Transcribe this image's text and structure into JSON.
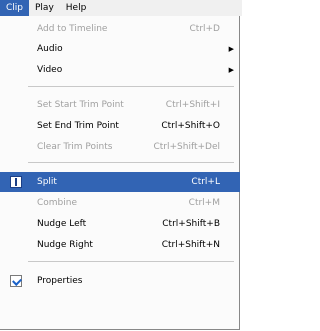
{
  "menubar": {
    "items": [
      {
        "label": "Clip",
        "active": true
      },
      {
        "label": "Play",
        "active": false
      },
      {
        "label": "Help",
        "active": false
      }
    ]
  },
  "menu": {
    "items": [
      {
        "label": "Add to Timeline",
        "shortcut": "Ctrl+D",
        "disabled": true
      },
      {
        "label": "Audio",
        "submenu": true
      },
      {
        "label": "Video",
        "submenu": true
      },
      {
        "label": "Set Start Trim Point",
        "shortcut": "Ctrl+Shift+I",
        "disabled": true
      },
      {
        "label": "Set End Trim Point",
        "shortcut": "Ctrl+Shift+O"
      },
      {
        "label": "Clear Trim Points",
        "shortcut": "Ctrl+Shift+Del",
        "disabled": true
      },
      {
        "label": "Split",
        "shortcut": "Ctrl+L",
        "highlighted": true,
        "icon": "split-icon"
      },
      {
        "label": "Combine",
        "shortcut": "Ctrl+M",
        "disabled": true
      },
      {
        "label": "Nudge Left",
        "shortcut": "Ctrl+Shift+B"
      },
      {
        "label": "Nudge Right",
        "shortcut": "Ctrl+Shift+N"
      },
      {
        "label": "Properties",
        "icon": "properties-icon"
      }
    ],
    "submenu_arrow": "▶"
  },
  "colors": {
    "highlight": "#3264b4",
    "disabled_text": "#a0a0a0",
    "menu_bg": "#fbfbfb"
  }
}
